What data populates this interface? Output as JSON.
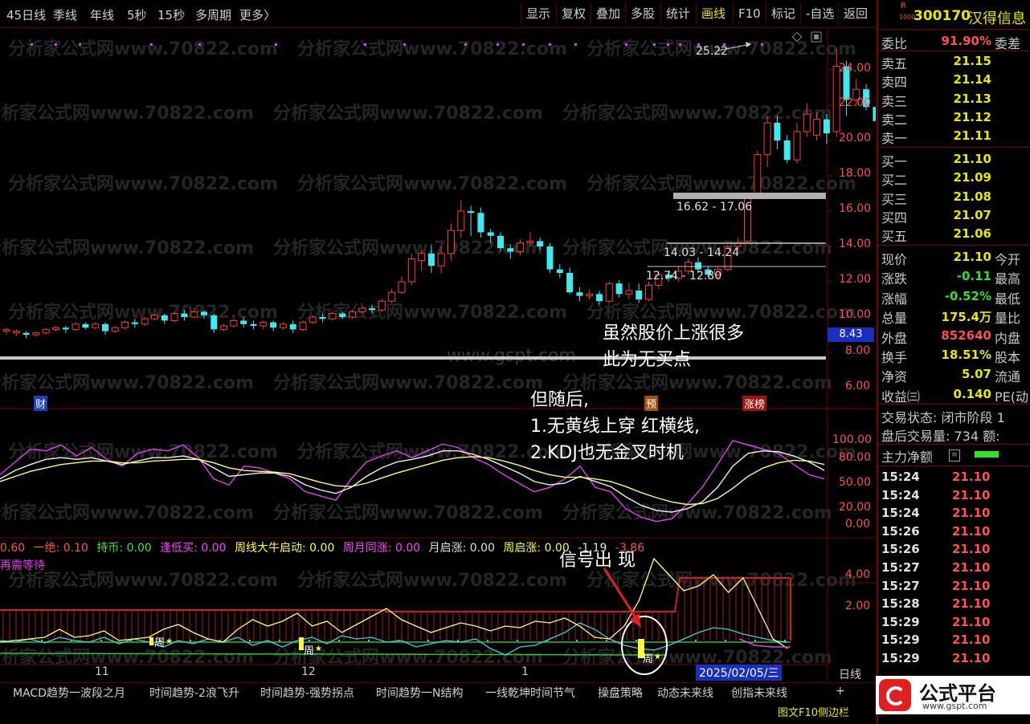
{
  "topbar": {
    "left_items": [
      "45日线",
      "季线",
      "年线",
      "5秒",
      "15秒",
      "多周期",
      "更多〉"
    ],
    "right_items": [
      "显示",
      "复权",
      "叠加",
      "多股",
      "统计",
      "画线",
      "F10",
      "标记",
      "-自选",
      "返回"
    ],
    "active_right": "画线"
  },
  "stock": {
    "badge": "R",
    "badge2": "1000",
    "code": "300170",
    "name": "汉得信息"
  },
  "quote": {
    "weibi_label": "委比",
    "weibi_value": "91.90%",
    "weibi_extra": "委差",
    "sells": [
      {
        "label": "卖五",
        "price": "21.15"
      },
      {
        "label": "卖四",
        "price": "21.14"
      },
      {
        "label": "卖三",
        "price": "21.13"
      },
      {
        "label": "卖二",
        "price": "21.12"
      },
      {
        "label": "卖一",
        "price": "21.11"
      }
    ],
    "buys": [
      {
        "label": "买一",
        "price": "21.10"
      },
      {
        "label": "买二",
        "price": "21.09"
      },
      {
        "label": "买三",
        "price": "21.08"
      },
      {
        "label": "买四",
        "price": "21.07"
      },
      {
        "label": "买五",
        "price": "21.06"
      }
    ],
    "stats": [
      {
        "label": "现价",
        "value": "21.10",
        "extra": "今开"
      },
      {
        "label": "涨跌",
        "value": "-0.11",
        "extra": "最高"
      },
      {
        "label": "涨幅",
        "value": "-0.52%",
        "extra": "最低"
      },
      {
        "label": "总量",
        "value": "175.4万",
        "extra": "量比"
      },
      {
        "label": "外盘",
        "value": "852640",
        "extra": "内盘"
      },
      {
        "label": "换手",
        "value": "18.51%",
        "extra": "股本"
      },
      {
        "label": "净资",
        "value": "5.07",
        "extra": "流通"
      },
      {
        "label": "收益㈢",
        "value": "0.140",
        "extra": "PE(动"
      }
    ],
    "trade_state": "交易状态: 闭市阶段 1",
    "after_hours": "盘后交易量: 734  额:",
    "main_flow_label": "主力净额",
    "ticks": [
      {
        "time": "15:24",
        "price": "21.10"
      },
      {
        "time": "15:24",
        "price": "21.10"
      },
      {
        "time": "15:24",
        "price": "21.10"
      },
      {
        "time": "15:26",
        "price": "21.10"
      },
      {
        "time": "15:26",
        "price": "21.10"
      },
      {
        "time": "15:27",
        "price": "21.10"
      },
      {
        "time": "15:27",
        "price": "21.10"
      },
      {
        "time": "15:28",
        "price": "21.10"
      },
      {
        "time": "15:29",
        "price": "21.10"
      },
      {
        "time": "15:29",
        "price": "21.10"
      },
      {
        "time": "15:29",
        "price": "21.10"
      }
    ]
  },
  "price_axis": {
    "labels": [
      "24.00",
      "22.00",
      "20.00",
      "18.00",
      "16.00",
      "14.00",
      "12.00",
      "10.00",
      "8.00",
      "6.00"
    ],
    "current_tag": "8.43"
  },
  "kdj_axis": {
    "labels": [
      "100.00",
      "80.00",
      "50.00",
      "20.00",
      "0.00"
    ]
  },
  "ind_axis": {
    "labels": [
      "4.00",
      "2.00"
    ]
  },
  "price_annotations": {
    "high": "25.22",
    "zone1": "16.62 - 17.06",
    "zone2": "14.03 - 14.24",
    "zone3": "12.74 - 12.80"
  },
  "markers": {
    "cai": "财",
    "yu": "预",
    "zhangbang": "涨榜",
    "zhou": "周",
    "star": "★"
  },
  "indicator_legend": [
    {
      "text": "0.60",
      "color": "#ff5050"
    },
    {
      "text": "一绝: 0.10",
      "color": "#ff5050"
    },
    {
      "text": "持币: 0.00",
      "color": "#40e040"
    },
    {
      "text": "逢低买: 0.00",
      "color": "#ff40ff"
    },
    {
      "text": "周线大牛启动: 0.00",
      "color": "#ffff40"
    },
    {
      "text": "周月同涨: 0.00",
      "color": "#ff40ff"
    },
    {
      "text": "月启涨: 0.00",
      "color": "#e0e0e0"
    },
    {
      "text": "周启涨: 0.00",
      "color": "#ffff40"
    },
    {
      "text": "-1.19",
      "color": "#e0e0e0"
    },
    {
      "text": "-3.86",
      "color": "#ff5050"
    }
  ],
  "indicator_note": "再需等待",
  "x_axis": {
    "labels": [
      "11",
      "12",
      "1"
    ],
    "date_tag": "2025/02/05/三",
    "period": "日线"
  },
  "annotations": {
    "a1": "虽然股价上涨很多",
    "a2": "此为无买点",
    "a3": "但随后,",
    "a4": "1.无黄线上穿 红横线,",
    "a5": "2.KDJ也无金叉时机",
    "a6": "信号出 现"
  },
  "watermarks": {
    "main": "分析家公式网www.70822.com",
    "site": "www.gspt.com"
  },
  "bottom_tabs": [
    "MACD趋势一波段之月",
    "时间趋势-2浪飞升",
    "时间趋势-强势拐点",
    "时间趋势一N结构",
    "一线乾坤时间节气",
    "操盘策略",
    "动态未来线",
    "创指未来线"
  ],
  "bottom_plus": "+",
  "logo": {
    "text": "公式平台",
    "url": "www.gspt.com"
  },
  "status_bar": "图文F10侧边栏",
  "colors": {
    "up": "#ff3a3a",
    "down": "#40e8f0",
    "grid": "#7a0000",
    "yellow": "#ffff70",
    "magenta": "#e040f0",
    "white": "#f0f0f0"
  }
}
